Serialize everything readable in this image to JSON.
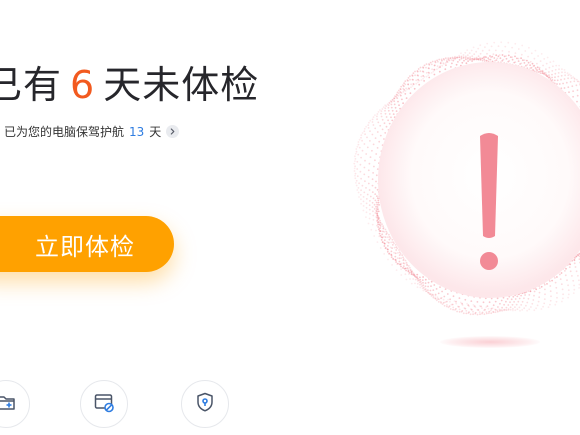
{
  "status": {
    "prefix": "已有",
    "days": "6",
    "suffix": "天未体检"
  },
  "protection": {
    "text": "已为您的电脑保驾护航",
    "days": "13",
    "unit": "天"
  },
  "primary_button": {
    "label": "立即体检"
  },
  "tools": [
    {
      "icon": "folder-add-icon"
    },
    {
      "icon": "window-block-icon"
    },
    {
      "icon": "shield-lock-icon"
    }
  ],
  "warning": {
    "icon": "exclamation-icon",
    "accent_color": "#f28a96"
  },
  "colors": {
    "accent_orange": "#ffa100",
    "days_highlight": "#f25a1f",
    "link_blue": "#2f7de1"
  }
}
